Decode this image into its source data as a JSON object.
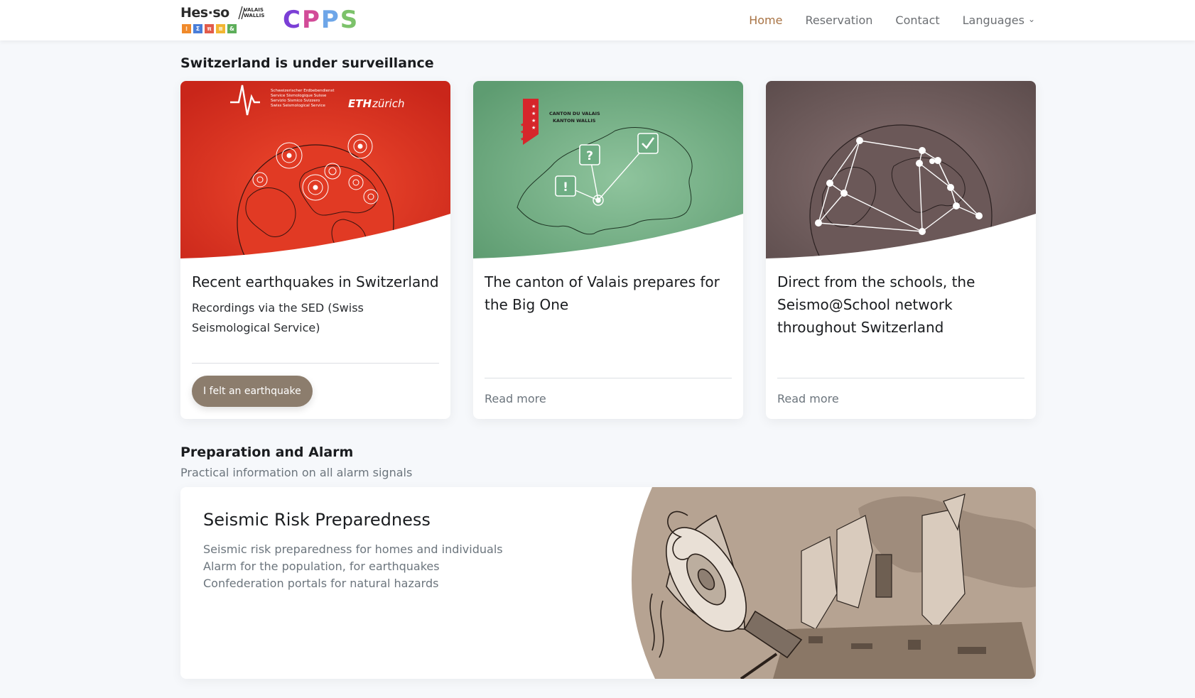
{
  "header": {
    "logo_hes": "Hes·so",
    "logo_hes_sub_1": "VALAIS",
    "logo_hes_sub_2": "WALLIS",
    "logo_tiles": [
      "⁝",
      "Σ",
      "π",
      "≡",
      "&"
    ],
    "logo_cpps": [
      "C",
      "P",
      "P",
      "S"
    ],
    "nav": [
      {
        "label": "Home",
        "active": true
      },
      {
        "label": "Reservation",
        "active": false
      },
      {
        "label": "Contact",
        "active": false
      },
      {
        "label": "Languages",
        "active": false,
        "dropdown": true
      }
    ]
  },
  "surveillance": {
    "title": "Switzerland is under surveillance",
    "cards": [
      {
        "title": "Recent earthquakes in Switzerland",
        "description": "Recordings via the SED (Swiss Seismological Service)",
        "button": "I felt an earthquake",
        "art_text_1": "Schweizerischer Erdbebendienst",
        "art_text_2": "Service Sismologique Suisse",
        "art_text_3": "Servizio Sismico Svizzero",
        "art_text_4": "Swiss Seismological Service",
        "art_text_eth": "ETH",
        "art_text_zurich": "zürich"
      },
      {
        "title": "The canton of Valais prepares for the Big One",
        "link": "Read more",
        "art_text_1": "CANTON DU VALAIS",
        "art_text_2": "KANTON WALLIS"
      },
      {
        "title": "Direct from the schools, the Seismo@School network throughout Switzerland",
        "link": "Read more"
      }
    ]
  },
  "preparation": {
    "title": "Preparation and Alarm",
    "subtitle": "Practical information on all alarm signals",
    "card": {
      "title": "Seismic Risk Preparedness",
      "lines": [
        "Seismic risk preparedness for homes and individuals",
        "Alarm for the population, for earthquakes",
        "Confederation portals for natural hazards"
      ]
    }
  },
  "colors": {
    "accent": "#a87344",
    "button": "#8c7d6d",
    "card1": "#e0341f",
    "card2": "#6fae84",
    "card3": "#6b5a5a"
  }
}
